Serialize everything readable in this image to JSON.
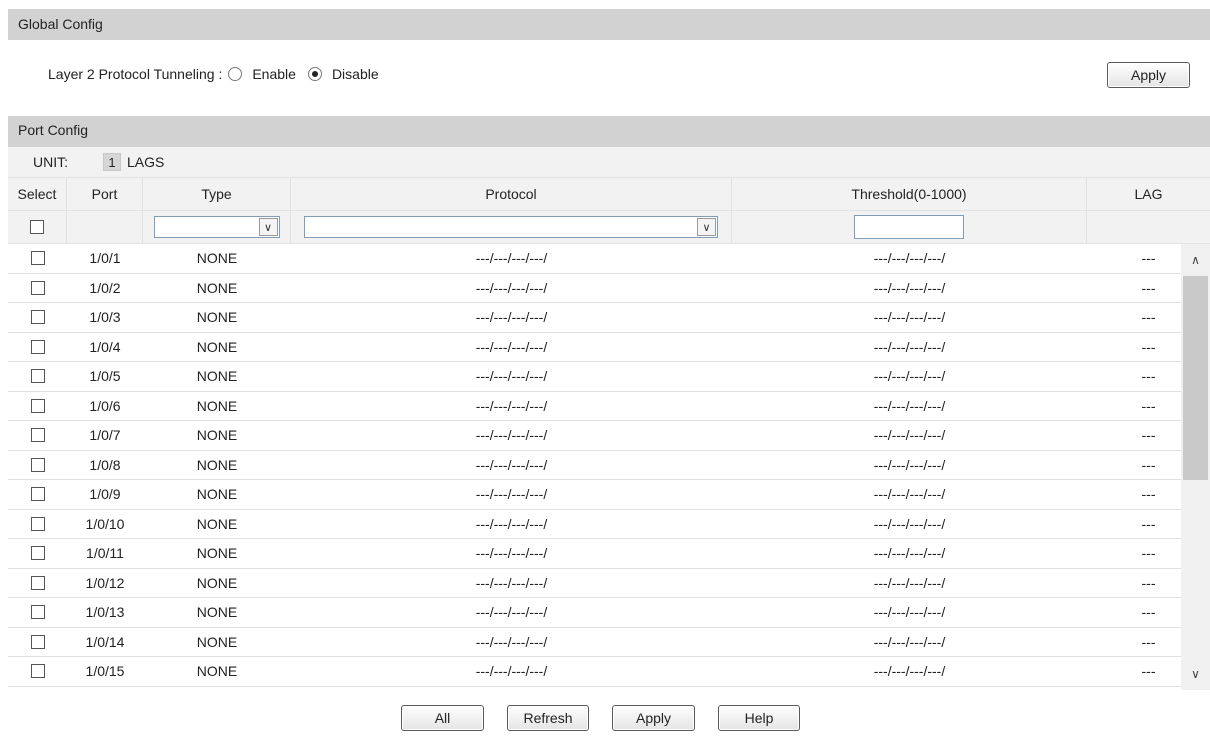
{
  "global": {
    "title": "Global Config",
    "tunneling_label": "Layer 2 Protocol Tunneling :",
    "options": [
      "Enable",
      "Disable"
    ],
    "selected": "Disable",
    "apply_label": "Apply"
  },
  "port": {
    "title": "Port Config",
    "unit_label": "UNIT:",
    "unit_value": "1",
    "lags_label": "LAGS",
    "columns": [
      "Select",
      "Port",
      "Type",
      "Protocol",
      "Threshold(0-1000)",
      "LAG"
    ],
    "rows": [
      {
        "port": "1/0/1",
        "type": "NONE",
        "protocol": "---/---/---/---/",
        "threshold": "---/---/---/---/",
        "lag": "---"
      },
      {
        "port": "1/0/2",
        "type": "NONE",
        "protocol": "---/---/---/---/",
        "threshold": "---/---/---/---/",
        "lag": "---"
      },
      {
        "port": "1/0/3",
        "type": "NONE",
        "protocol": "---/---/---/---/",
        "threshold": "---/---/---/---/",
        "lag": "---"
      },
      {
        "port": "1/0/4",
        "type": "NONE",
        "protocol": "---/---/---/---/",
        "threshold": "---/---/---/---/",
        "lag": "---"
      },
      {
        "port": "1/0/5",
        "type": "NONE",
        "protocol": "---/---/---/---/",
        "threshold": "---/---/---/---/",
        "lag": "---"
      },
      {
        "port": "1/0/6",
        "type": "NONE",
        "protocol": "---/---/---/---/",
        "threshold": "---/---/---/---/",
        "lag": "---"
      },
      {
        "port": "1/0/7",
        "type": "NONE",
        "protocol": "---/---/---/---/",
        "threshold": "---/---/---/---/",
        "lag": "---"
      },
      {
        "port": "1/0/8",
        "type": "NONE",
        "protocol": "---/---/---/---/",
        "threshold": "---/---/---/---/",
        "lag": "---"
      },
      {
        "port": "1/0/9",
        "type": "NONE",
        "protocol": "---/---/---/---/",
        "threshold": "---/---/---/---/",
        "lag": "---"
      },
      {
        "port": "1/0/10",
        "type": "NONE",
        "protocol": "---/---/---/---/",
        "threshold": "---/---/---/---/",
        "lag": "---"
      },
      {
        "port": "1/0/11",
        "type": "NONE",
        "protocol": "---/---/---/---/",
        "threshold": "---/---/---/---/",
        "lag": "---"
      },
      {
        "port": "1/0/12",
        "type": "NONE",
        "protocol": "---/---/---/---/",
        "threshold": "---/---/---/---/",
        "lag": "---"
      },
      {
        "port": "1/0/13",
        "type": "NONE",
        "protocol": "---/---/---/---/",
        "threshold": "---/---/---/---/",
        "lag": "---"
      },
      {
        "port": "1/0/14",
        "type": "NONE",
        "protocol": "---/---/---/---/",
        "threshold": "---/---/---/---/",
        "lag": "---"
      },
      {
        "port": "1/0/15",
        "type": "NONE",
        "protocol": "---/---/---/---/",
        "threshold": "---/---/---/---/",
        "lag": "---"
      }
    ]
  },
  "buttons": {
    "all": "All",
    "refresh": "Refresh",
    "apply": "Apply",
    "help": "Help"
  },
  "icons": {
    "dropdown": "chevron-down-icon",
    "scroll_up": "chevron-up-icon",
    "scroll_down": "chevron-down-icon"
  }
}
